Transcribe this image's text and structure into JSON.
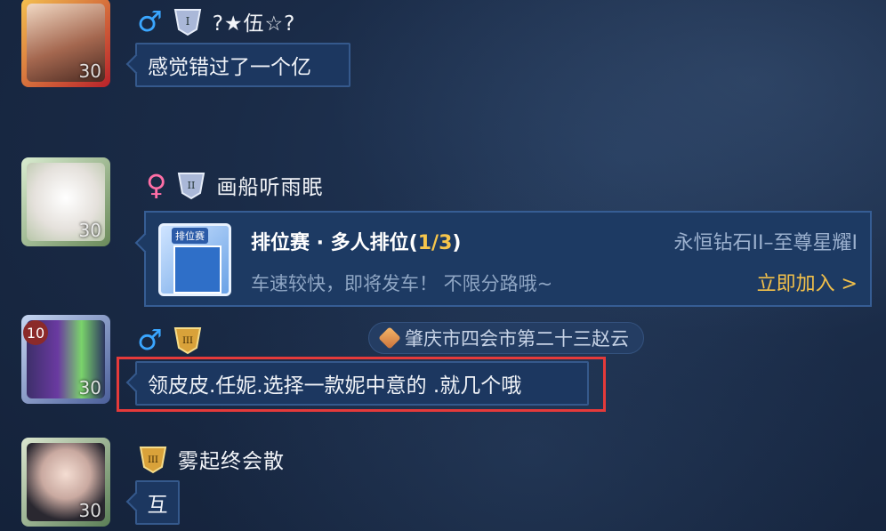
{
  "messages": [
    {
      "gender": "♂",
      "tier": "I",
      "nick": "?★伍☆?",
      "level": "30",
      "text": "感觉错过了一个亿"
    },
    {
      "gender": "♀",
      "tier": "II",
      "nick": "画船听雨眠",
      "level": "30",
      "card": {
        "icon_tag": "排位赛",
        "title_main": "排位赛 · 多人排位(",
        "title_count": "1/3",
        "title_end": ")",
        "rank_range": "永恒钻石II–至尊星耀I",
        "subtitle": "车速较快，即将发车！ 不限分路哦~",
        "join": "立即加入 >"
      }
    },
    {
      "gender": "♂",
      "tier": "III",
      "nick": "",
      "level": "30",
      "badge_level": "10",
      "location": "肇庆市四会市第二十三赵云",
      "text": "领皮皮.任妮.选择一款妮中意的 .就几个哦"
    },
    {
      "gender": "",
      "tier": "III",
      "nick": "雾起终会散",
      "level": "30",
      "text": "互"
    }
  ],
  "colors": {
    "highlight": "#e53a3a",
    "accent": "#f2c04a",
    "male": "#3aa6ff",
    "female": "#ff6fa6"
  }
}
